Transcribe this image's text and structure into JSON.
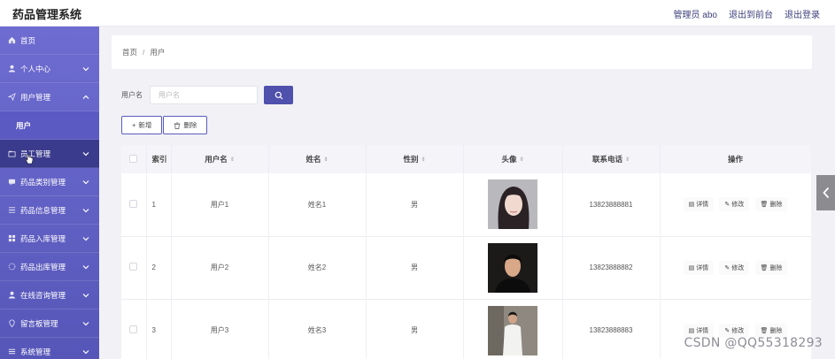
{
  "app": {
    "title": "药品管理系统"
  },
  "header": {
    "links": [
      "管理员 abo",
      "退出到前台",
      "退出登录"
    ]
  },
  "sidebar": {
    "items": [
      {
        "label": "首页",
        "icon": "home-icon",
        "expandable": false
      },
      {
        "label": "个人中心",
        "icon": "person-icon",
        "expandable": true
      },
      {
        "label": "用户管理",
        "icon": "send-icon",
        "expandable": true,
        "expanded": true
      },
      {
        "label": "用户",
        "sub": true
      },
      {
        "label": "员工管理",
        "icon": "folder-icon",
        "expandable": true,
        "active": true
      },
      {
        "label": "药品类别管理",
        "icon": "chat-icon",
        "expandable": true
      },
      {
        "label": "药品信息管理",
        "icon": "list-icon",
        "expandable": true
      },
      {
        "label": "药品入库管理",
        "icon": "grid-icon",
        "expandable": true
      },
      {
        "label": "药品出库管理",
        "icon": "compass-icon",
        "expandable": true
      },
      {
        "label": "在线咨询管理",
        "icon": "person-icon",
        "expandable": true
      },
      {
        "label": "留言板管理",
        "icon": "pin-icon",
        "expandable": true
      },
      {
        "label": "系统管理",
        "icon": "menu-icon",
        "expandable": true
      }
    ]
  },
  "breadcrumb": {
    "home": "首页",
    "sep": "/",
    "current": "用户"
  },
  "search": {
    "label": "用户名",
    "placeholder": "用户名",
    "value": ""
  },
  "toolbar": {
    "add_label": "新增",
    "delete_label": "删除"
  },
  "table": {
    "columns": [
      "",
      "索引",
      "用户名",
      "姓名",
      "性别",
      "头像",
      "联系电话",
      "操作"
    ],
    "sortable": [
      false,
      false,
      true,
      true,
      true,
      true,
      true,
      false
    ],
    "rows": [
      {
        "index": "1",
        "username": "用户1",
        "name": "姓名1",
        "gender": "男",
        "phone": "13823888881",
        "avatar": "avatar-female"
      },
      {
        "index": "2",
        "username": "用户2",
        "name": "姓名2",
        "gender": "男",
        "phone": "13823888882",
        "avatar": "avatar-male-dark"
      },
      {
        "index": "3",
        "username": "用户3",
        "name": "姓名3",
        "gender": "男",
        "phone": "13823888883",
        "avatar": "avatar-male-white"
      }
    ],
    "row_actions": {
      "detail": "详情",
      "edit": "修改",
      "delete": "删除"
    }
  },
  "watermark": "CSDN @QQ55318293",
  "colors": {
    "sidebar_top": "#6e6cd0",
    "sidebar_bottom": "#5656b9",
    "accent": "#4f51ad",
    "active_item": "#3a3b8d"
  }
}
